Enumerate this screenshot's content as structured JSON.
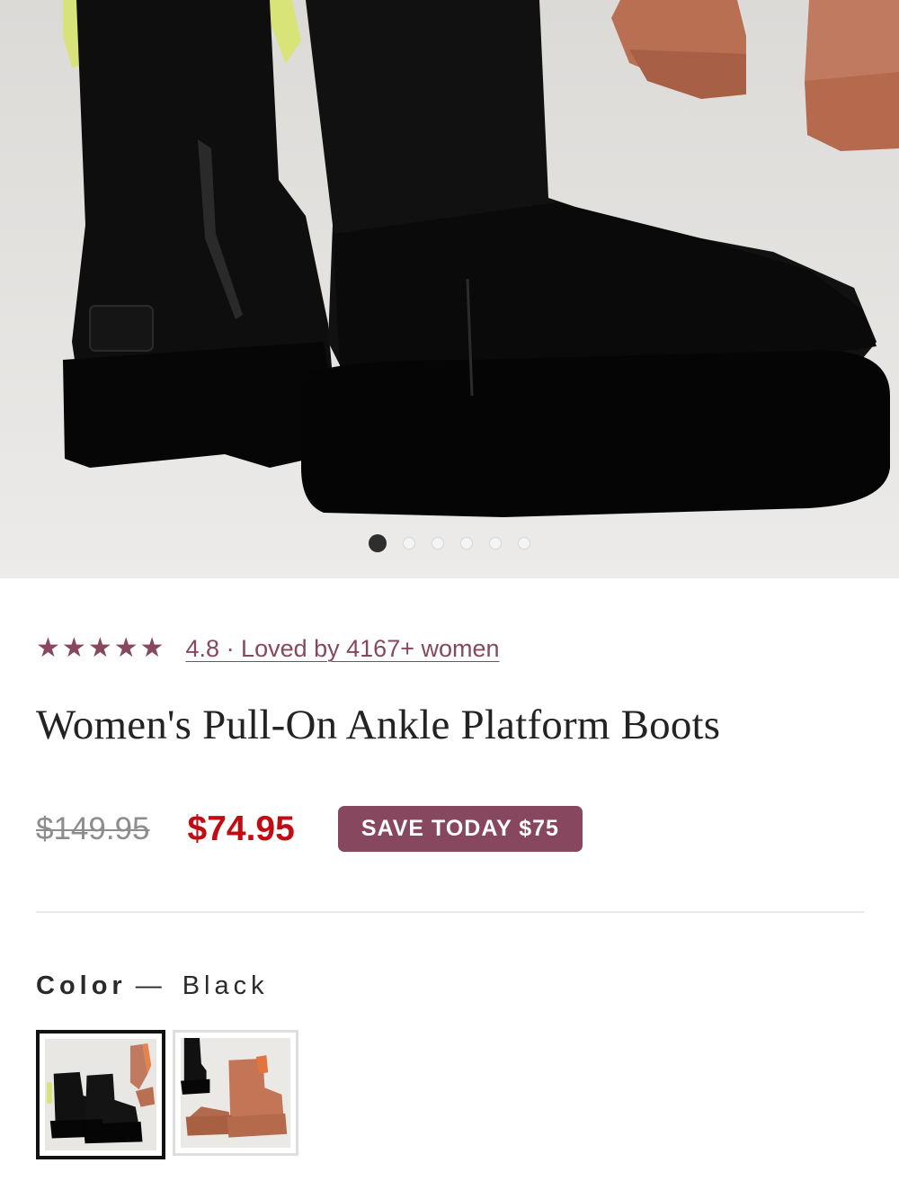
{
  "gallery": {
    "image_label": "Women's Pull-On Ankle Platform Boots photo",
    "dot_count": 6,
    "active_index": 0
  },
  "rating": {
    "stars": 5,
    "score_text": "4.8 · Loved by 4167+ women",
    "star_color": "#87475e"
  },
  "product": {
    "title": "Women's Pull-On Ankle Platform Boots"
  },
  "pricing": {
    "original_price": "$149.95",
    "sale_price": "$74.95",
    "save_badge": "SAVE TODAY $75",
    "sale_color": "#c00d14",
    "badge_color": "#87475e"
  },
  "color": {
    "label": "Color",
    "separator": "—",
    "selected_value": "Black",
    "options": [
      {
        "name": "Black",
        "selected": true
      },
      {
        "name": "Chestnut",
        "selected": false
      }
    ]
  }
}
